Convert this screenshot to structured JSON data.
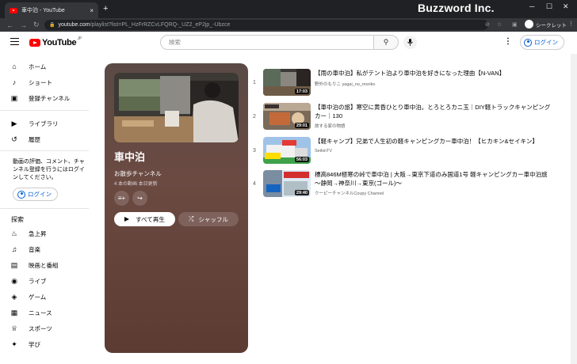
{
  "browser": {
    "tab_title": "車中泊 - YouTube",
    "tab_close": "×",
    "new_tab": "+",
    "brand": "Buzzword Inc.",
    "url_host": "youtube.com",
    "url_path": "/playlist?list=PL_HzFrRZCvLFQRQ-_UZ2_eP2jp_-Ubzce",
    "incognito_label": "シークレット",
    "minimize": "─",
    "maximize": "☐",
    "close": "✕",
    "back": "←",
    "forward": "→",
    "reload": "↻",
    "lock": "🔒",
    "url_icon_1": "⊘",
    "url_icon_2": "☆",
    "url_icon_3": "▣",
    "menu": "⋮"
  },
  "header": {
    "logo_text": "YouTube",
    "logo_suffix": "JP",
    "search_placeholder": "検索",
    "search_icon": "⚲",
    "mic_icon": "🎤",
    "more_icon": "⋮",
    "login_label": "ログイン"
  },
  "sidebar": {
    "items_top": [
      {
        "icon": "⌂",
        "label": "ホーム"
      },
      {
        "icon": "♪",
        "label": "ショート"
      },
      {
        "icon": "▣",
        "label": "登録チャンネル"
      }
    ],
    "items_mid": [
      {
        "icon": "▶",
        "label": "ライブラリ"
      },
      {
        "icon": "↺",
        "label": "履歴"
      }
    ],
    "login_note": "動画の評価、コメント、チャンネル登録を行うにはログインしてください。",
    "login_label": "ログイン",
    "explore_heading": "探索",
    "items_explore": [
      {
        "icon": "♨",
        "label": "急上昇"
      },
      {
        "icon": "♫",
        "label": "音楽"
      },
      {
        "icon": "▤",
        "label": "映画と番組"
      },
      {
        "icon": "◉",
        "label": "ライブ"
      },
      {
        "icon": "◈",
        "label": "ゲーム"
      },
      {
        "icon": "▦",
        "label": "ニュース"
      },
      {
        "icon": "♕",
        "label": "スポーツ"
      },
      {
        "icon": "✦",
        "label": "学び"
      }
    ]
  },
  "playlist": {
    "title": "車中泊",
    "channel": "お散歩チャンネル",
    "meta": "4 本の動画  本日更新",
    "icon_save": "≡+",
    "icon_share": "↪",
    "play_all_label": "すべて再生",
    "shuffle_label": "シャッフル",
    "shuffle_icon": "⤮"
  },
  "videos": [
    {
      "index": "1",
      "title": "【雨の車中泊】私がテント泊より車中泊を好きになった理由【N-VAN】",
      "channel": "野外のもりこ yagai_no_moriko",
      "duration": "17:03"
    },
    {
      "index": "2",
      "title": "【車中泊の旅】寒空に黄昏ひとり車中泊。とろとろカニ玉｜DIY軽トラックキャンピングカー｜130",
      "channel": "旅する家の物語",
      "duration": "29:01"
    },
    {
      "index": "3",
      "title": "【軽キャンプ】兄弟で人生初の軽キャンピングカー車中泊！【ヒカキン&セイキン】",
      "channel": "SeikinTV",
      "duration": "56:03"
    },
    {
      "index": "4",
      "title": "標高846M極寒の峠で車中泊 | 大阪→東京下道のみ国道1号 軽キャンピングカー車中泊旅 〜静岡→神奈川→東京(ゴール)〜",
      "channel": "クーピーチャンネルCoupy Channel",
      "duration": "29:40"
    }
  ],
  "colors": {
    "panel_brown": "#6b4a42",
    "yt_red": "#ff0000",
    "link_blue": "#065fd4"
  }
}
